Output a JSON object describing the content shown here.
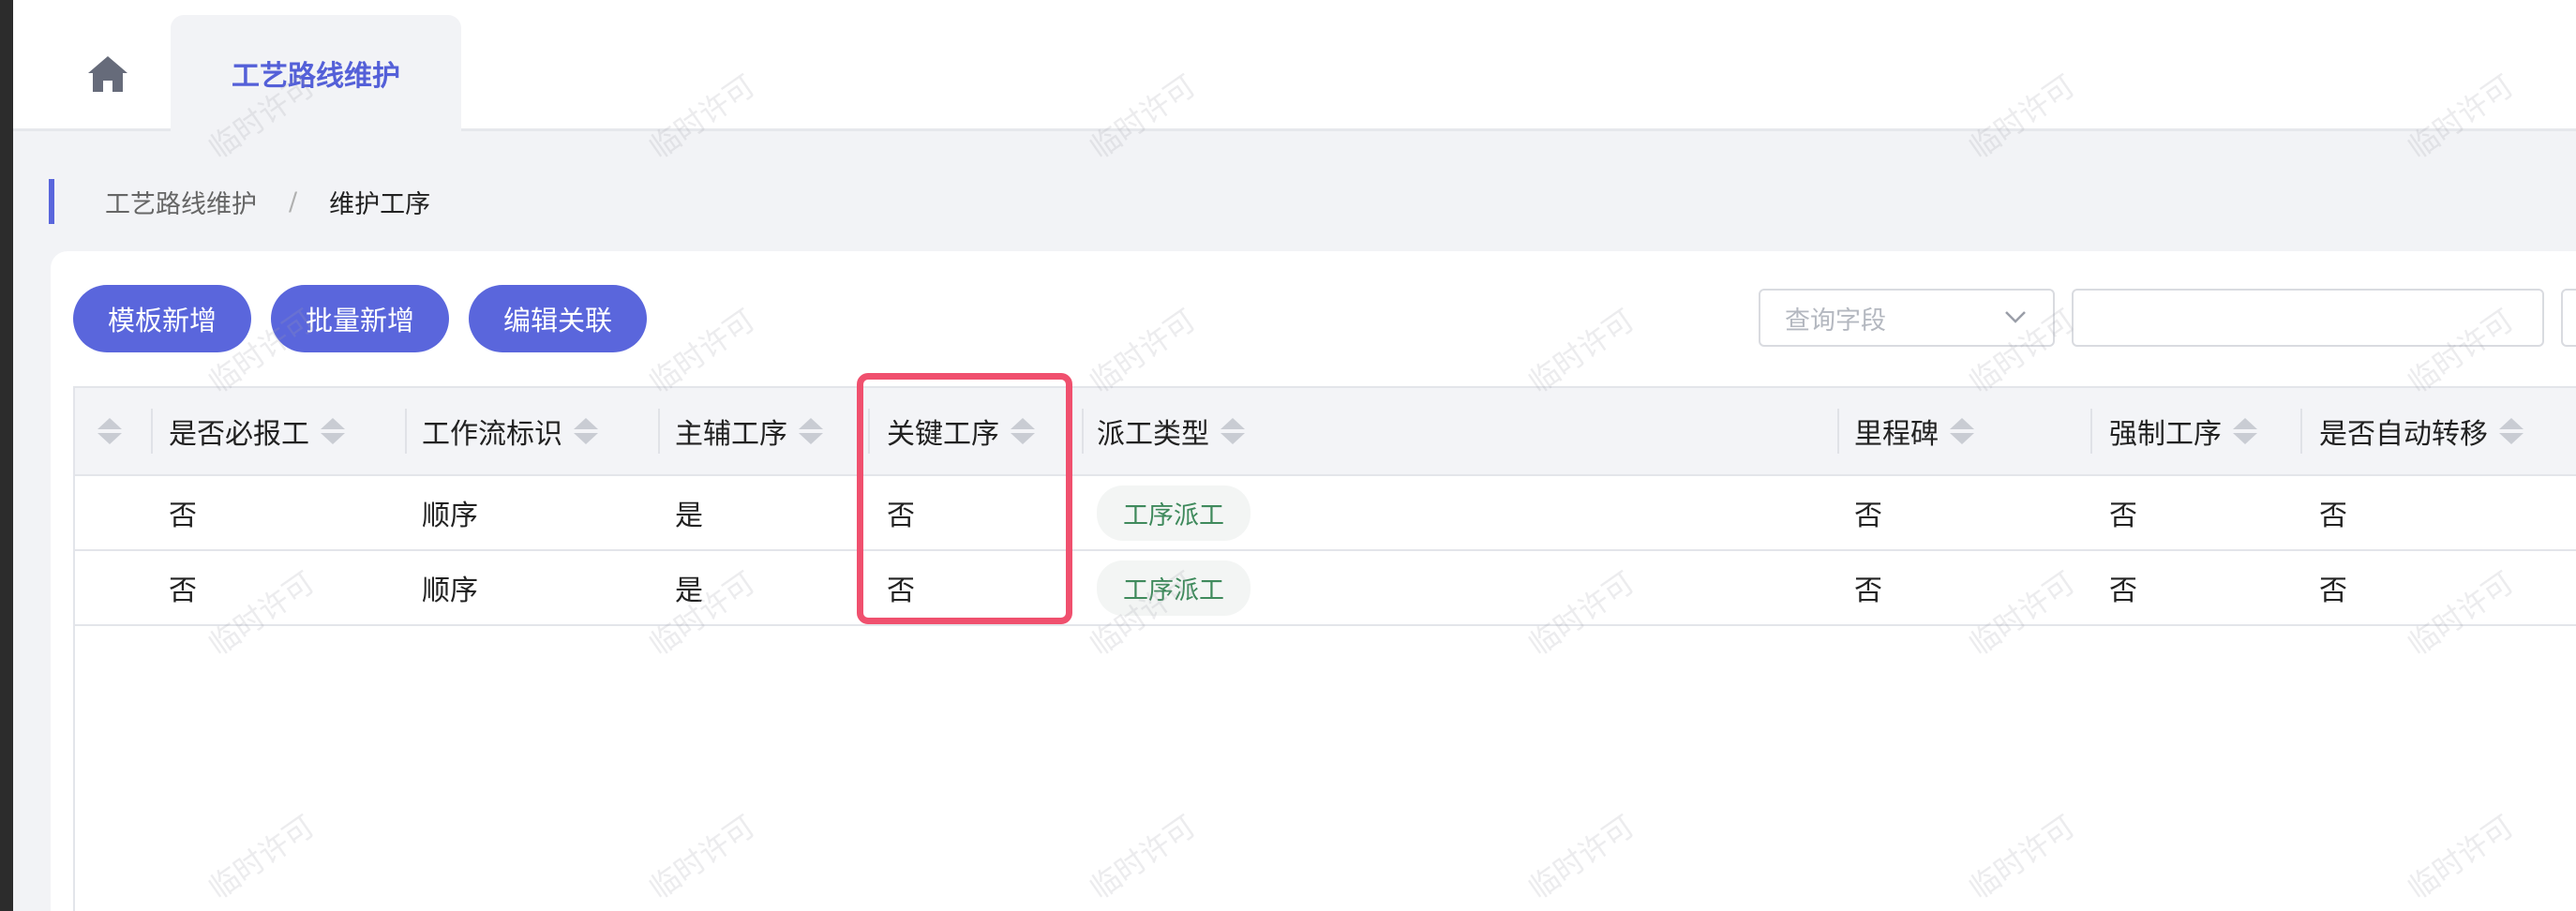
{
  "tabs": {
    "home_icon": "home-icon",
    "active_label": "工艺路线维护"
  },
  "breadcrumb": {
    "items": [
      "工艺路线维护",
      "维护工序"
    ],
    "separator": "/"
  },
  "toolbar": {
    "buttons": [
      "模板新增",
      "批量新增",
      "编辑关联"
    ],
    "field_select_placeholder": "查询字段",
    "search_value": ""
  },
  "table": {
    "columns": [
      "是否必报工",
      "工作流标识",
      "主辅工序",
      "关键工序",
      "派工类型",
      "里程碑",
      "强制工序",
      "是否自动转移"
    ],
    "rows": [
      [
        "否",
        "顺序",
        "是",
        "否",
        "工序派工",
        "否",
        "否",
        "否"
      ],
      [
        "否",
        "顺序",
        "是",
        "否",
        "工序派工",
        "否",
        "否",
        "否"
      ]
    ]
  },
  "watermark": "临时许可",
  "colors": {
    "primary": "#5a66dc",
    "highlight": "#f0506e",
    "tag_text": "#3f8a5c"
  }
}
